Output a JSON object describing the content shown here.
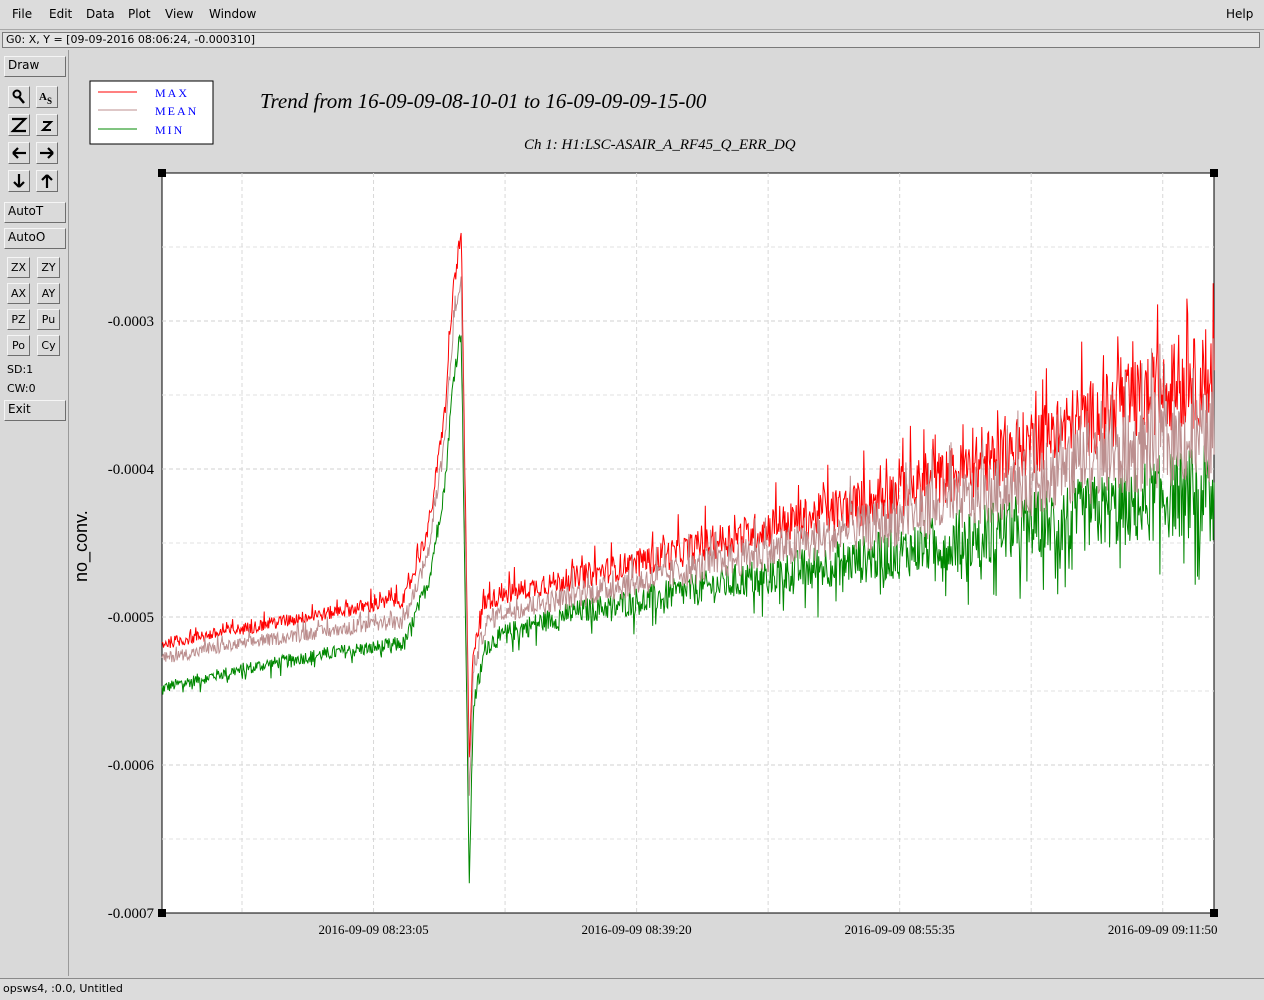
{
  "menu": {
    "file": "File",
    "edit": "Edit",
    "data": "Data",
    "plot": "Plot",
    "view": "View",
    "window": "Window",
    "help": "Help"
  },
  "cursor_readout": "G0: X, Y = [09-09-2016 08:06:24, -0.000310]",
  "toolbar": {
    "draw": "Draw",
    "autot": "AutoT",
    "autoo": "AutoO",
    "zx": "ZX",
    "zy": "ZY",
    "ax": "AX",
    "ay": "AY",
    "pz": "PZ",
    "pu": "Pu",
    "po": "Po",
    "cy": "Cy",
    "sd": "SD:1",
    "cw": "CW:0",
    "exit": "Exit",
    "icons": [
      "magnify-icon",
      "text-scale-icon",
      "zoom-z-icon",
      "zoom-small-z-icon",
      "arrow-left-icon",
      "arrow-right-icon",
      "arrow-down-icon",
      "arrow-up-icon"
    ]
  },
  "status_bar": "opsws4, :0.0, Untitled",
  "chart_data": {
    "type": "line",
    "title": "Trend from 16-09-09-08-10-01 to 16-09-09-09-15-00",
    "subtitle": "Ch 1: H1:LSC-ASAIR_A_RF45_Q_ERR_DQ",
    "ylabel": "no_conv.",
    "xlabel": "",
    "x_ticks": [
      "2016-09-09 08:23:05",
      "2016-09-09 08:39:20",
      "2016-09-09 08:55:35",
      "2016-09-09 09:11:50"
    ],
    "y_ticks": [
      "-0.0003",
      "-0.0004",
      "-0.0005",
      "-0.0006",
      "-0.0007"
    ],
    "x_range": [
      "2016-09-09 08:10:01",
      "2016-09-09 09:15:00"
    ],
    "ylim": [
      -0.0007,
      -0.0002
    ],
    "grid": true,
    "legend_position": "top-left",
    "series": [
      {
        "name": "MAX",
        "color": "#ff0000",
        "x": [
          "08:10:01",
          "08:15:00",
          "08:20:00",
          "08:25:00",
          "08:26:30",
          "08:27:30",
          "08:28:00",
          "08:28:30",
          "08:29:00",
          "08:29:15",
          "08:30:00",
          "08:31:00",
          "08:35:00",
          "08:40:00",
          "08:45:00",
          "08:50:00",
          "08:55:00",
          "09:00:00",
          "09:05:00",
          "09:10:00",
          "09:12:00",
          "09:15:00"
        ],
        "y": [
          -0.000518,
          -0.000508,
          -0.000498,
          -0.000488,
          -0.00044,
          -0.00036,
          -0.00028,
          -0.00024,
          -0.0006,
          -0.00052,
          -0.00049,
          -0.000485,
          -0.000475,
          -0.000462,
          -0.000447,
          -0.000433,
          -0.000418,
          -0.0004,
          -0.000375,
          -0.000355,
          -0.000345,
          -0.00034
        ]
      },
      {
        "name": "MEAN",
        "color": "#bc8f8f",
        "x": [
          "08:10:01",
          "08:15:00",
          "08:20:00",
          "08:25:00",
          "08:26:30",
          "08:27:30",
          "08:28:00",
          "08:28:30",
          "08:29:00",
          "08:29:15",
          "08:30:00",
          "08:31:00",
          "08:35:00",
          "08:40:00",
          "08:45:00",
          "08:50:00",
          "08:55:00",
          "09:00:00",
          "09:05:00",
          "09:10:00",
          "09:12:00",
          "09:15:00"
        ],
        "y": [
          -0.000528,
          -0.000518,
          -0.00051,
          -0.000503,
          -0.000455,
          -0.00038,
          -0.000305,
          -0.00027,
          -0.000625,
          -0.000535,
          -0.000505,
          -0.000497,
          -0.000487,
          -0.000475,
          -0.000462,
          -0.00045,
          -0.000436,
          -0.00042,
          -0.000405,
          -0.00039,
          -0.000383,
          -0.000378
        ]
      },
      {
        "name": "MIN",
        "color": "#008800",
        "x": [
          "08:10:01",
          "08:15:00",
          "08:20:00",
          "08:25:00",
          "08:26:30",
          "08:27:30",
          "08:28:00",
          "08:28:30",
          "08:29:00",
          "08:29:15",
          "08:30:00",
          "08:31:00",
          "08:35:00",
          "08:40:00",
          "08:45:00",
          "08:50:00",
          "08:55:00",
          "09:00:00",
          "09:05:00",
          "09:10:00",
          "09:12:00",
          "09:15:00"
        ],
        "y": [
          -0.000548,
          -0.000535,
          -0.000525,
          -0.000518,
          -0.000475,
          -0.00041,
          -0.00034,
          -0.000305,
          -0.00068,
          -0.00056,
          -0.00052,
          -0.000512,
          -0.000498,
          -0.000488,
          -0.000477,
          -0.000467,
          -0.000458,
          -0.000445,
          -0.000435,
          -0.000425,
          -0.000418,
          -0.000415
        ]
      }
    ]
  }
}
